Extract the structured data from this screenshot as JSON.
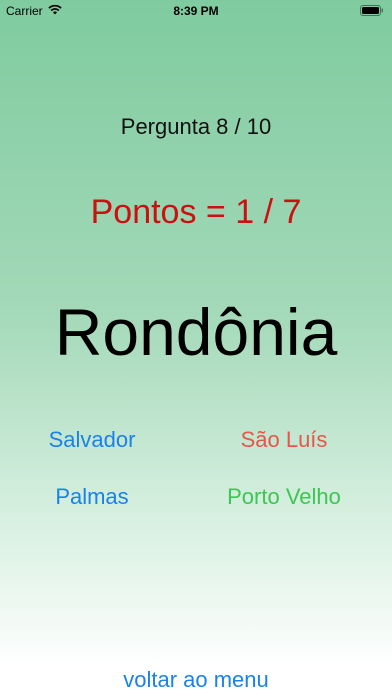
{
  "status_bar": {
    "carrier": "Carrier",
    "time": "8:39 PM",
    "wifi_icon": "wifi-icon",
    "battery_icon": "battery-icon"
  },
  "quiz": {
    "question_counter": "Pergunta 8 / 10",
    "score": "Pontos = 1 / 7",
    "state": "Rondônia",
    "answers": [
      {
        "label": "Salvador",
        "color": "#1a82e8"
      },
      {
        "label": "São Luís",
        "color": "#e8554a"
      },
      {
        "label": "Palmas",
        "color": "#1a82e8"
      },
      {
        "label": "Porto Velho",
        "color": "#3dc653"
      }
    ],
    "back_to_menu": "voltar ao menu",
    "score_color": "#cc1010",
    "link_color": "#1a82e8"
  }
}
